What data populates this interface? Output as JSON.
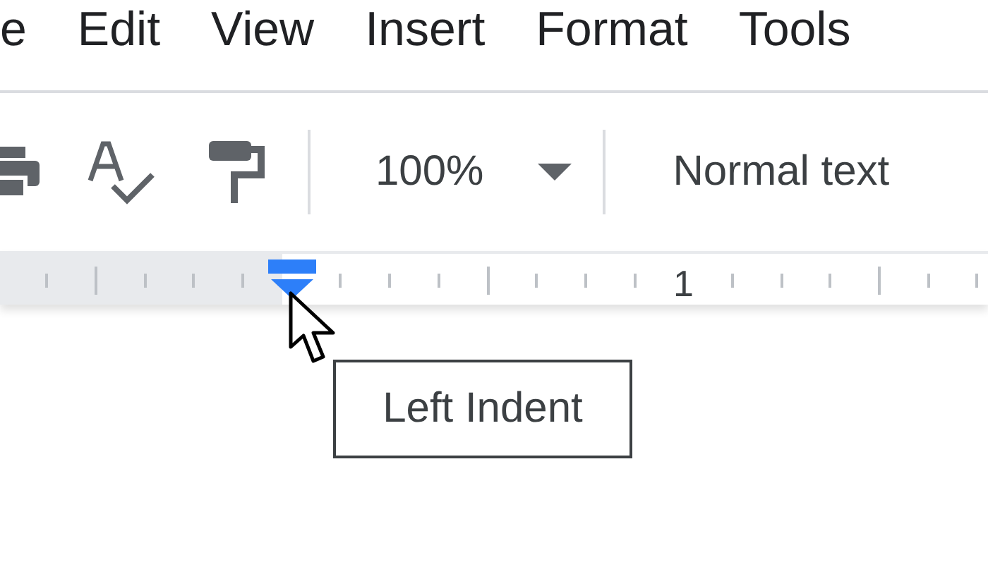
{
  "menu": [
    "e",
    "Edit",
    "View",
    "Insert",
    "Format",
    "Tools"
  ],
  "toolbar": {
    "zoom": "100%",
    "style": "Normal text"
  },
  "ruler": {
    "label": "1"
  },
  "tooltip": "Left Indent"
}
